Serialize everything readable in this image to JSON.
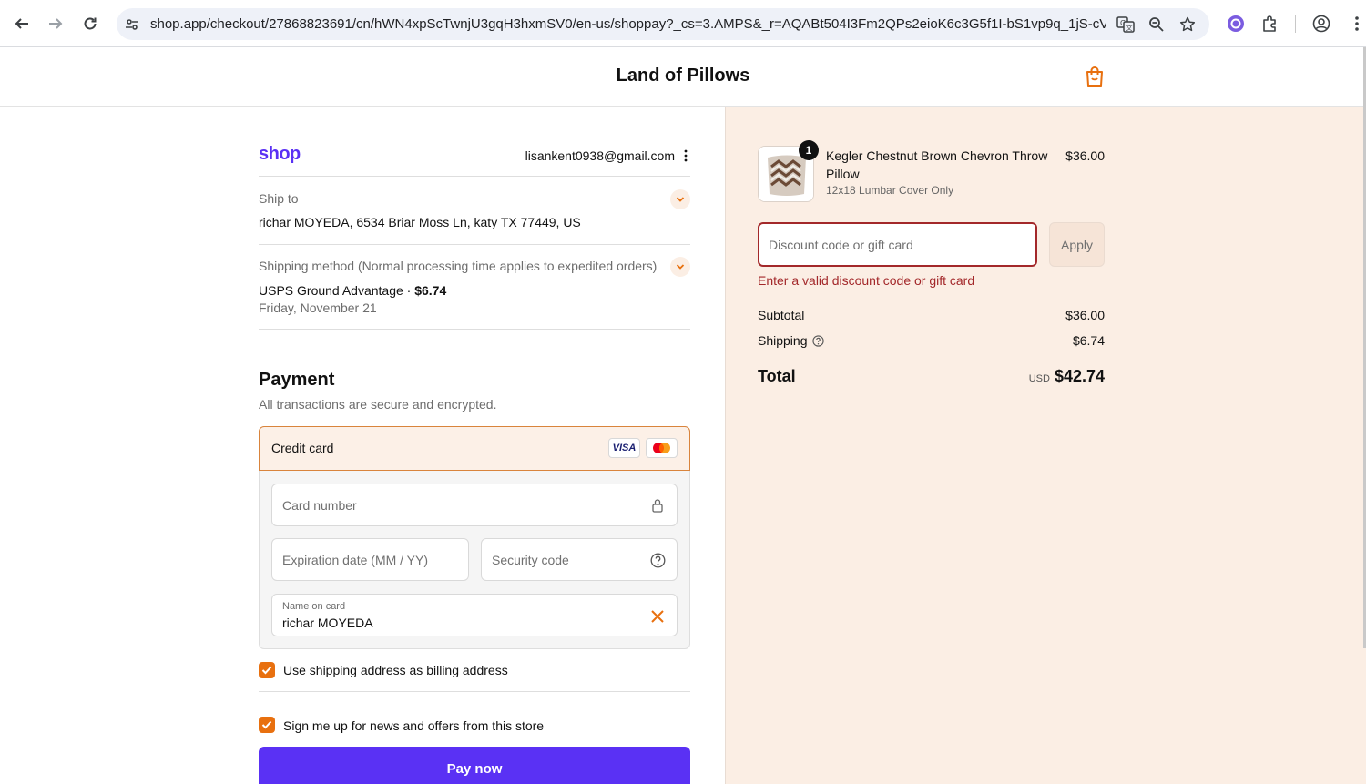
{
  "browser": {
    "url": "shop.app/checkout/27868823691/cn/hWN4xpScTwnjU3gqH3hxmSV0/en-us/shoppay?_cs=3.AMPS&_r=AQABt504I3Fm2QPs2eioK6c3G5f1I-bS1vp9q_1jS-cV&re..."
  },
  "header": {
    "store_name": "Land of Pillows"
  },
  "account": {
    "brand": "shop",
    "email": "lisankent0938@gmail.com"
  },
  "ship_to": {
    "label": "Ship to",
    "address": "richar MOYEDA, 6534 Briar Moss Ln, katy TX 77449, US"
  },
  "shipping_method": {
    "label": "Shipping method (Normal processing time applies to expedited orders)",
    "service": "USPS Ground Advantage · ",
    "price": "$6.74",
    "date": "Friday, November 21"
  },
  "payment": {
    "title": "Payment",
    "subtitle": "All transactions are secure and encrypted.",
    "method_label": "Credit card",
    "visa_label": "VISA",
    "card_number_placeholder": "Card number",
    "expiration_placeholder": "Expiration date (MM / YY)",
    "security_placeholder": "Security code",
    "name_label": "Name on card",
    "name_value": "richar MOYEDA",
    "billing_checkbox_label": "Use shipping address as billing address",
    "billing_checked": true,
    "newsletter_label": "Sign me up for news and offers from this store",
    "newsletter_checked": true,
    "pay_button": "Pay now"
  },
  "order": {
    "quantity": "1",
    "product_name": "Kegler Chestnut Brown Chevron Throw Pillow",
    "product_variant": "12x18 Lumbar Cover Only",
    "product_price": "$36.00",
    "discount_placeholder": "Discount code or gift card",
    "apply_button": "Apply",
    "discount_error": "Enter a valid discount code or gift card",
    "subtotal_label": "Subtotal",
    "subtotal_value": "$36.00",
    "shipping_label": "Shipping",
    "shipping_value": "$6.74",
    "total_label": "Total",
    "total_currency": "USD",
    "total_value": "$42.74"
  },
  "colors": {
    "shop_brand": "#5a31f4",
    "accent_orange": "#e8700f",
    "error_red": "#a3282a",
    "summary_bg": "#fbeee4"
  }
}
